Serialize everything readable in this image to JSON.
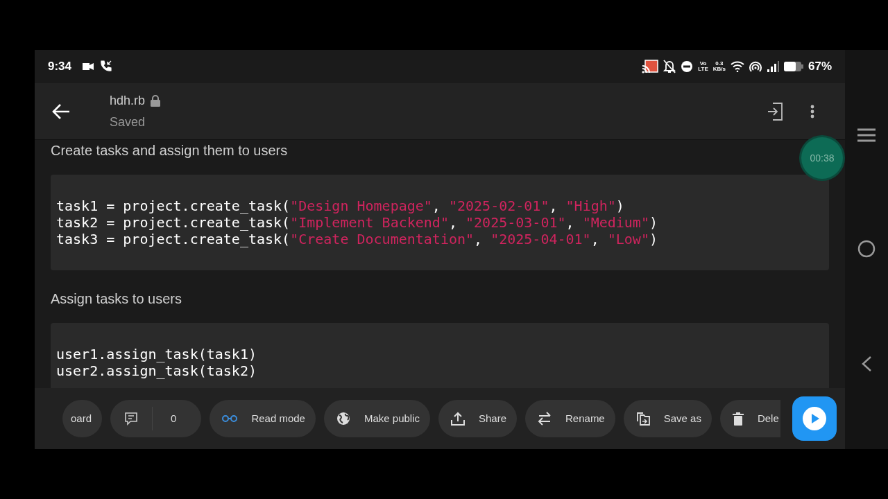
{
  "status_bar": {
    "time": "9:34",
    "network": [
      "Vo",
      "LTE"
    ],
    "speed": [
      "0.3",
      "KB/s"
    ],
    "battery": "67%"
  },
  "header": {
    "title": "hdh.rb",
    "subtitle": "Saved"
  },
  "timer": "00:38",
  "sections": [
    {
      "kind": "text",
      "text": "Create tasks and assign them to users"
    },
    {
      "kind": "code",
      "lines": [
        [
          {
            "kind": "plain",
            "text": "task1 = project.create_task("
          },
          {
            "kind": "string",
            "text": "\"Design Homepage\""
          },
          {
            "kind": "plain",
            "text": ", "
          },
          {
            "kind": "string",
            "text": "\"2025-02-01\""
          },
          {
            "kind": "plain",
            "text": ", "
          },
          {
            "kind": "string",
            "text": "\"High\""
          },
          {
            "kind": "plain",
            "text": ")"
          }
        ],
        [
          {
            "kind": "plain",
            "text": "task2 = project.create_task("
          },
          {
            "kind": "string",
            "text": "\"Implement Backend\""
          },
          {
            "kind": "plain",
            "text": ", "
          },
          {
            "kind": "string",
            "text": "\"2025-03-01\""
          },
          {
            "kind": "plain",
            "text": ", "
          },
          {
            "kind": "string",
            "text": "\"Medium\""
          },
          {
            "kind": "plain",
            "text": ")"
          }
        ],
        [
          {
            "kind": "plain",
            "text": "task3 = project.create_task("
          },
          {
            "kind": "string",
            "text": "\"Create Documentation\""
          },
          {
            "kind": "plain",
            "text": ", "
          },
          {
            "kind": "string",
            "text": "\"2025-04-01\""
          },
          {
            "kind": "plain",
            "text": ", "
          },
          {
            "kind": "string",
            "text": "\"Low\""
          },
          {
            "kind": "plain",
            "text": ")"
          }
        ]
      ]
    },
    {
      "kind": "text",
      "text": "Assign tasks to users"
    },
    {
      "kind": "code",
      "lines": [
        [
          {
            "kind": "plain",
            "text": "user1.assign_task(task1)"
          }
        ],
        [
          {
            "kind": "plain",
            "text": "user2.assign_task(task2)"
          }
        ]
      ]
    }
  ],
  "toolbar": [
    {
      "kind": "action",
      "label": "oard"
    },
    {
      "kind": "counter",
      "count": "0"
    },
    {
      "kind": "action",
      "label": "Read mode"
    },
    {
      "kind": "action",
      "label": "Make public"
    },
    {
      "kind": "action",
      "label": "Share"
    },
    {
      "kind": "action",
      "label": "Rename"
    },
    {
      "kind": "action",
      "label": "Save as"
    },
    {
      "kind": "action",
      "label": "Dele"
    }
  ]
}
